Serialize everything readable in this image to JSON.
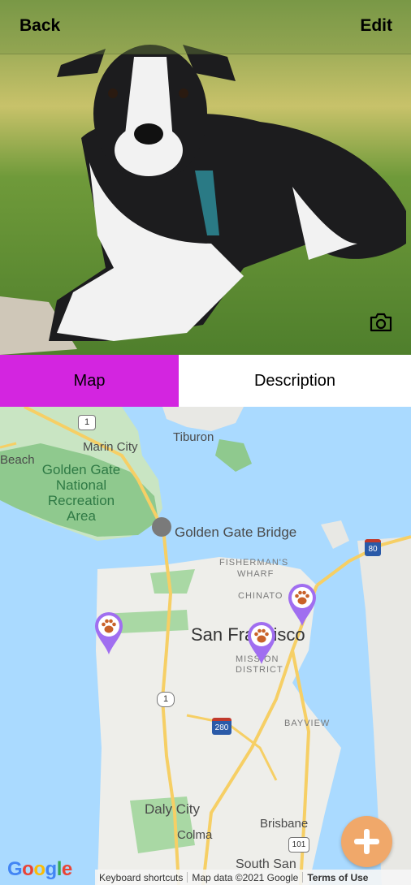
{
  "header": {
    "back_label": "Back",
    "edit_label": "Edit"
  },
  "tabs": [
    {
      "label": "Map",
      "active": true
    },
    {
      "label": "Description",
      "active": false
    }
  ],
  "colors": {
    "active_tab": "#d325e0",
    "pin": "#a06ef0",
    "fab": "#f0a86a"
  },
  "icons": {
    "camera": "camera-icon",
    "paw": "paw-icon",
    "fab": "plus-icon"
  },
  "map": {
    "labels": {
      "marin_city": "Marin City",
      "tiburon": "Tiburon",
      "beach": "Beach",
      "ggnra_line1": "Golden Gate",
      "ggnra_line2": "National",
      "ggnra_line3": "Recreation",
      "ggnra_line4": "Area",
      "golden_gate_bridge": "Golden Gate Bridge",
      "fishermans_wharf_1": "FISHERMAN'S",
      "fishermans_wharf_2": "WHARF",
      "chinatown": "CHINATO",
      "san_francisco": "San Francisco",
      "mission_1": "MISSION",
      "mission_2": "DISTRICT",
      "bayview": "BAYVIEW",
      "daly_city": "Daly City",
      "colma": "Colma",
      "brisbane": "Brisbane",
      "south_san": "South San",
      "hwy1_a": "1",
      "hwy1_b": "1",
      "hwy80": "80",
      "hwy280": "280",
      "hwy101": "101"
    },
    "google": "Google",
    "attribution": {
      "keyboard": "Keyboard shortcuts",
      "map_data": "Map data ©2021 Google",
      "terms": "Terms of Use"
    }
  }
}
